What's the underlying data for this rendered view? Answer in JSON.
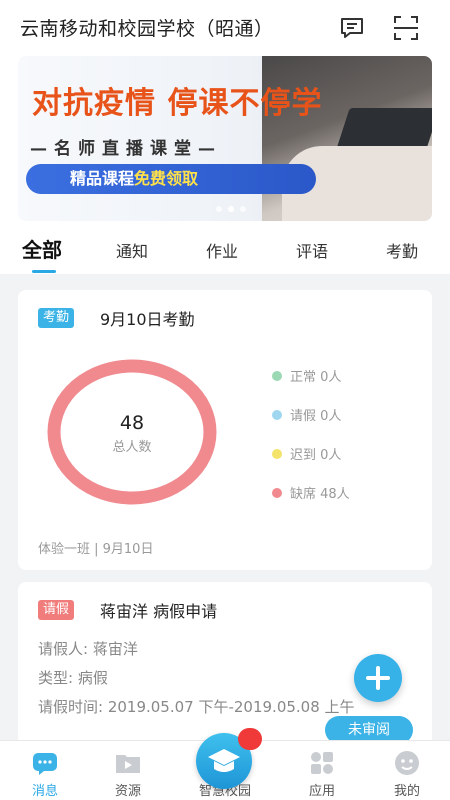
{
  "header": {
    "title": "云南移动和校园学校（昭通）"
  },
  "banner": {
    "headline": "对抗疫情  停课不停学",
    "subline": "—名师直播课堂—",
    "pill_prefix": "精品课程",
    "pill_free": "免费领取",
    "pill_suffix": ""
  },
  "tabs": [
    {
      "label": "全部"
    },
    {
      "label": "通知"
    },
    {
      "label": "作业"
    },
    {
      "label": "评语"
    },
    {
      "label": "考勤"
    }
  ],
  "attendance_card": {
    "tag": "考勤",
    "title": "9月10日考勤",
    "total": "48",
    "total_label": "总人数",
    "legend": [
      {
        "label": "正常 0人",
        "color": "#9ad9b4"
      },
      {
        "label": "请假 0人",
        "color": "#9fd6f0"
      },
      {
        "label": "迟到 0人",
        "color": "#f3e36a"
      },
      {
        "label": "缺席 48人",
        "color": "#f08a8f"
      }
    ],
    "ring_color": "#f08a8f",
    "footer": "体验一班 | 9月10日"
  },
  "leave_card": {
    "tag": "请假",
    "title": "蒋宙洋 病假申请",
    "applicant": "请假人:  蒋宙洋",
    "type": "类型:  病假",
    "time": "请假时间:  2019.05.07 下午-2019.05.08 上午",
    "status": "未审阅"
  },
  "bottom_nav": [
    {
      "label": "消息",
      "icon": "message-icon"
    },
    {
      "label": "资源",
      "icon": "resource-icon"
    },
    {
      "label": "智慧校园",
      "icon": "graduation-cap-icon"
    },
    {
      "label": "应用",
      "icon": "apps-icon"
    },
    {
      "label": "我的",
      "icon": "profile-icon"
    }
  ],
  "colors": {
    "accent": "#2aa8e6",
    "absent": "#f08a8f"
  }
}
